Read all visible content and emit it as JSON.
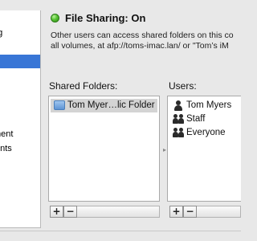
{
  "services": {
    "items": [
      {
        "label": "ng",
        "selected": false
      },
      {
        "label": "",
        "selected": true
      },
      {
        "label": "ment",
        "selected": false
      },
      {
        "label": "ents",
        "selected": false
      },
      {
        "label": "g",
        "selected": false
      }
    ]
  },
  "status": {
    "title": "File Sharing: On",
    "line1": "Other users can access shared folders on this co",
    "line2": "all volumes, at afp://toms-imac.lan/ or \"Tom’s iM"
  },
  "shared_folders": {
    "label": "Shared Folders:",
    "items": [
      {
        "label": "Tom Myer…lic Folder",
        "icon": "shared-folder-icon",
        "selected": true
      }
    ]
  },
  "users": {
    "label": "Users:",
    "items": [
      {
        "label": "Tom Myers",
        "icon": "user-icon"
      },
      {
        "label": "Staff",
        "icon": "group-icon"
      },
      {
        "label": "Everyone",
        "icon": "group-icon"
      }
    ]
  },
  "buttons": {
    "add": "+",
    "remove": "−"
  },
  "colors": {
    "status_green": "#56c233",
    "selection_blue": "#3876d6"
  }
}
